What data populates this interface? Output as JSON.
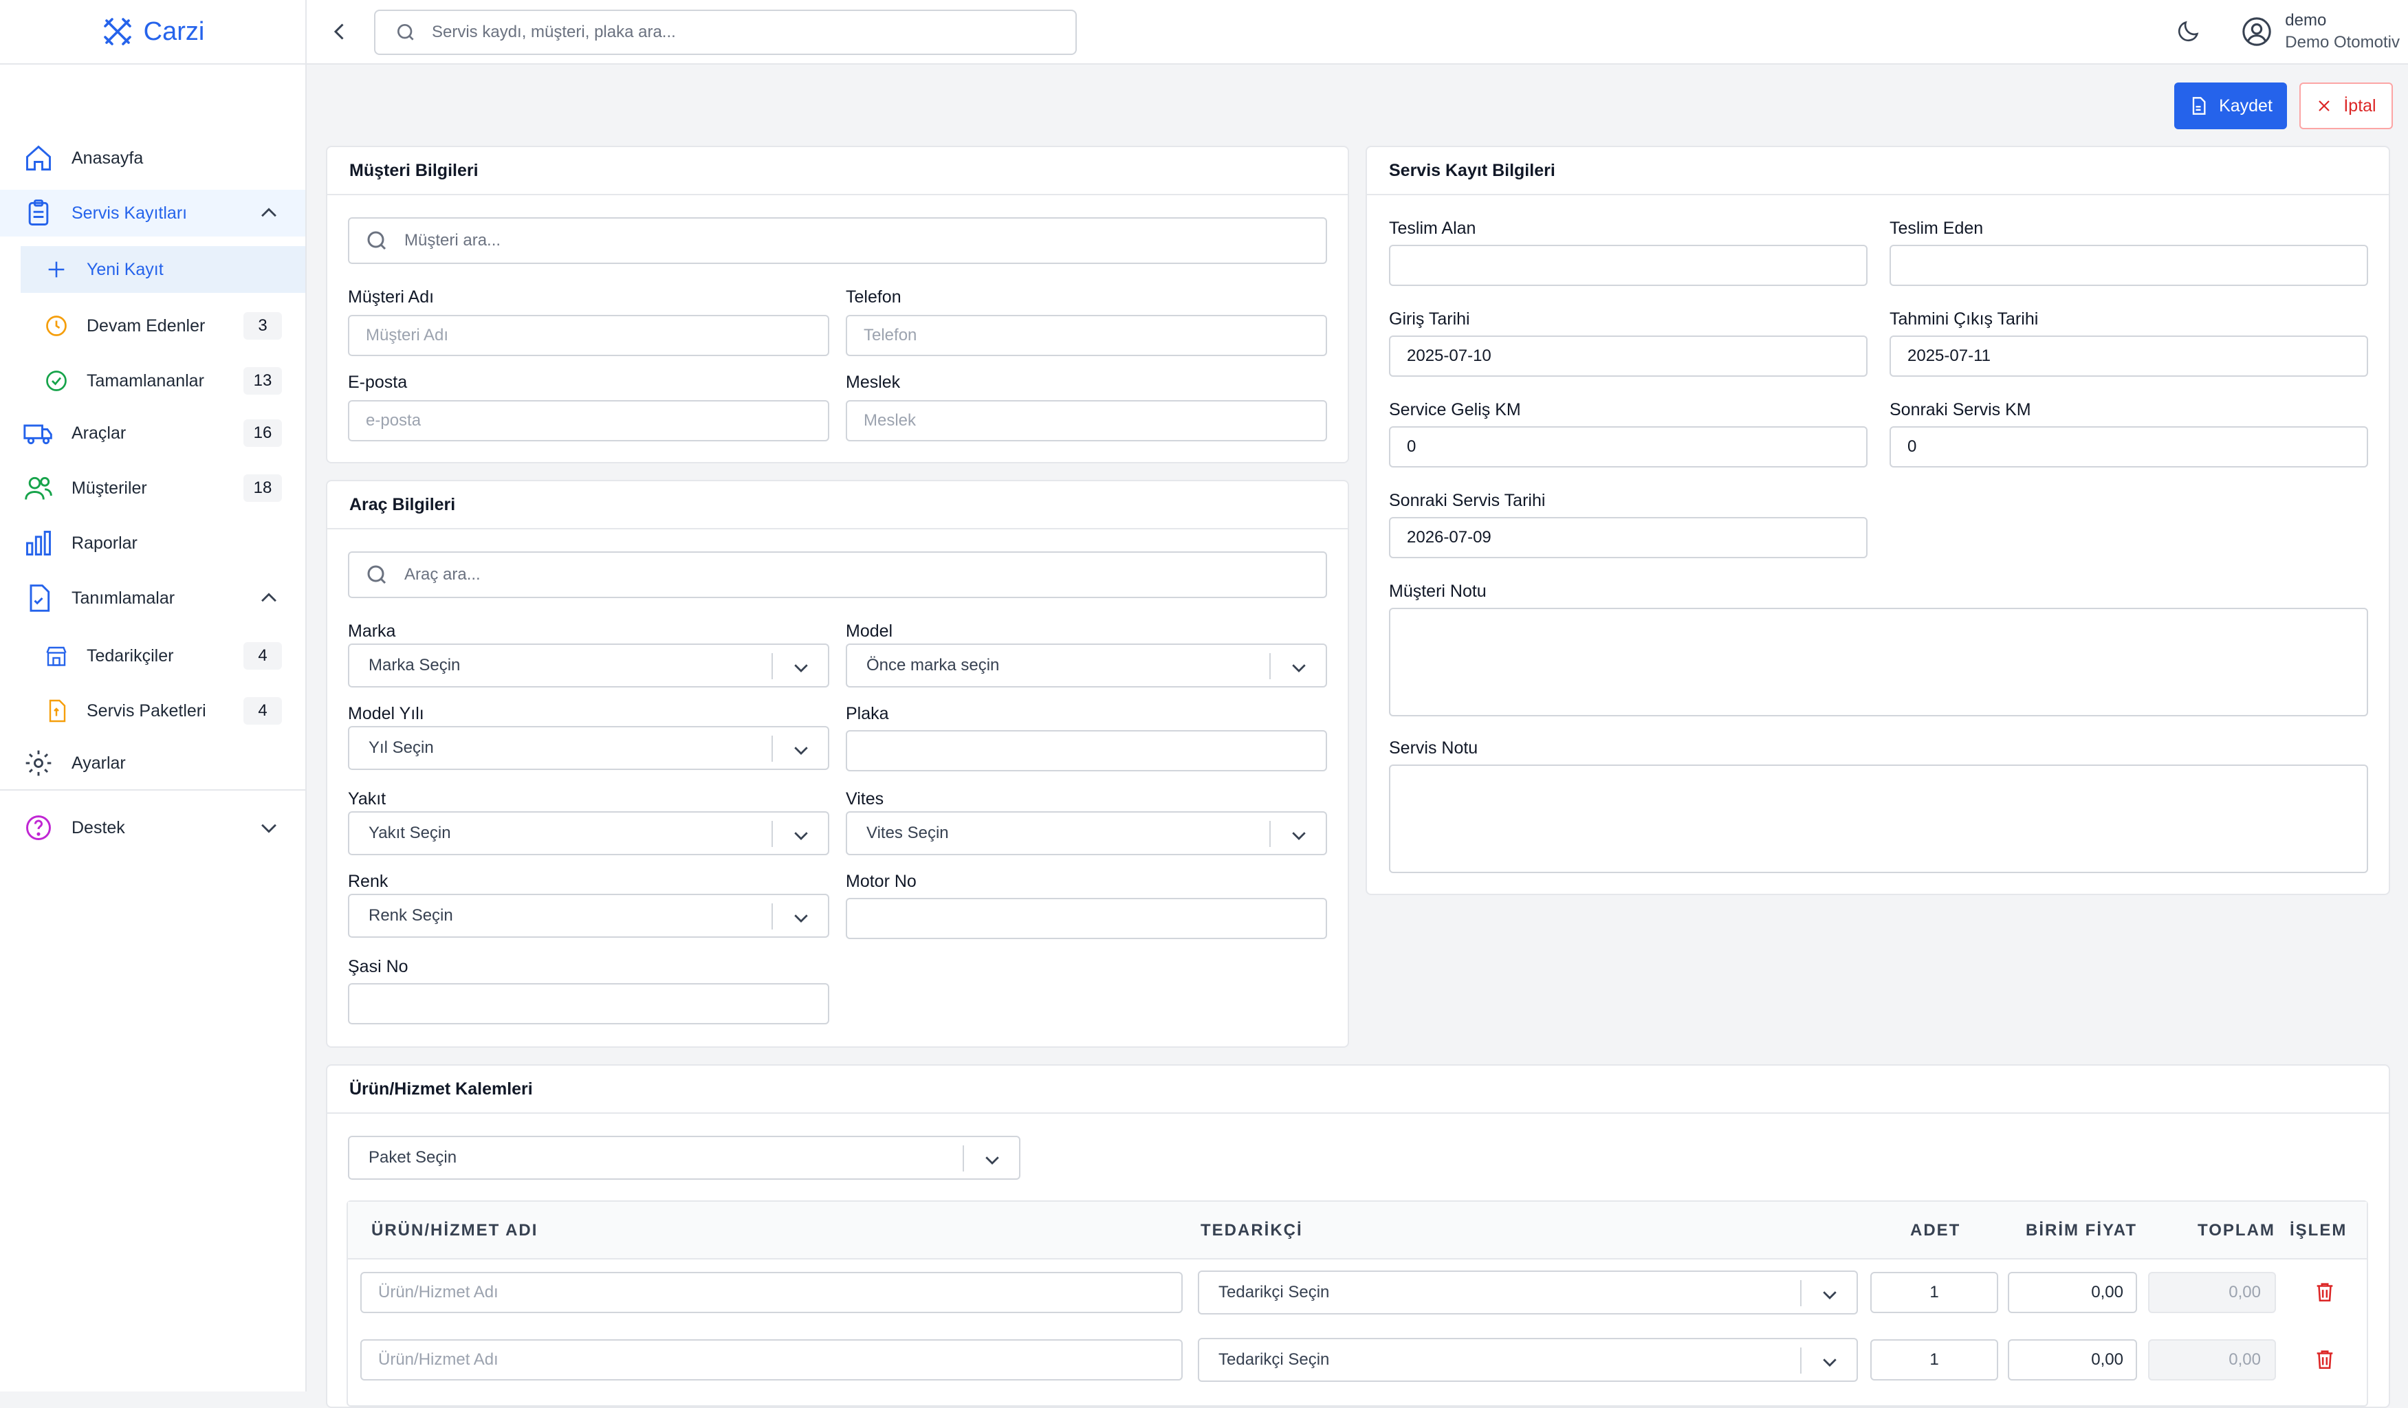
{
  "app": {
    "brand": "Carzi"
  },
  "sidebar": {
    "home": "Anasayfa",
    "service_records": "Servis Kayıtları",
    "new_record": "Yeni Kayıt",
    "ongoing": {
      "label": "Devam Edenler",
      "count": "3"
    },
    "completed": {
      "label": "Tamamlananlar",
      "count": "13"
    },
    "vehicles": {
      "label": "Araçlar",
      "count": "16"
    },
    "customers": {
      "label": "Müşteriler",
      "count": "18"
    },
    "reports": "Raporlar",
    "definitions": "Tanımlamalar",
    "suppliers": {
      "label": "Tedarikçiler",
      "count": "4"
    },
    "packages": {
      "label": "Servis Paketleri",
      "count": "4"
    },
    "settings": "Ayarlar",
    "support": "Destek"
  },
  "topbar": {
    "search_placeholder": "Servis kaydı, müşteri, plaka ara...",
    "user_name": "demo",
    "company": "Demo Otomotiv"
  },
  "actions": {
    "save": "Kaydet",
    "cancel": "İptal"
  },
  "customer": {
    "title": "Müşteri Bilgileri",
    "search_placeholder": "Müşteri ara...",
    "name_label": "Müşteri Adı",
    "name_placeholder": "Müşteri Adı",
    "phone_label": "Telefon",
    "phone_placeholder": "Telefon",
    "email_label": "E-posta",
    "email_placeholder": "e-posta",
    "job_label": "Meslek",
    "job_placeholder": "Meslek"
  },
  "vehicle": {
    "title": "Araç Bilgileri",
    "search_placeholder": "Araç ara...",
    "brand_label": "Marka",
    "brand_value": "Marka Seçin",
    "model_label": "Model",
    "model_value": "Önce marka seçin",
    "year_label": "Model Yılı",
    "year_value": "Yıl Seçin",
    "plate_label": "Plaka",
    "fuel_label": "Yakıt",
    "fuel_value": "Yakıt Seçin",
    "gear_label": "Vites",
    "gear_value": "Vites Seçin",
    "color_label": "Renk",
    "color_value": "Renk Seçin",
    "engine_label": "Motor No",
    "chassis_label": "Şasi No"
  },
  "service": {
    "title": "Servis Kayıt Bilgileri",
    "received_by_label": "Teslim Alan",
    "delivered_by_label": "Teslim Eden",
    "entry_date_label": "Giriş Tarihi",
    "entry_date": "2025-07-10",
    "exit_date_label": "Tahmini Çıkış Tarihi",
    "exit_date": "2025-07-11",
    "km_label": "Service Geliş KM",
    "km": "0",
    "next_km_label": "Sonraki Servis KM",
    "next_km": "0",
    "next_date_label": "Sonraki Servis Tarihi",
    "next_date": "2026-07-09",
    "customer_note_label": "Müşteri Notu",
    "service_note_label": "Servis Notu"
  },
  "items": {
    "title": "Ürün/Hizmet Kalemleri",
    "package_select": "Paket Seçin",
    "headers": {
      "name": "ÜRÜN/HİZMET ADI",
      "supplier": "TEDARİKÇİ",
      "qty": "ADET",
      "unit_price": "BİRİM FİYAT",
      "total": "TOPLAM",
      "action": "İŞLEM"
    },
    "rows": [
      {
        "name_placeholder": "Ürün/Hizmet Adı",
        "supplier": "Tedarikçi Seçin",
        "qty": "1",
        "unit_price": "0,00",
        "total": "0,00"
      },
      {
        "name_placeholder": "Ürün/Hizmet Adı",
        "supplier": "Tedarikçi Seçin",
        "qty": "1",
        "unit_price": "0,00",
        "total": "0,00"
      }
    ]
  },
  "colors": {
    "accent": "#2563eb",
    "danger": "#dc2626"
  }
}
